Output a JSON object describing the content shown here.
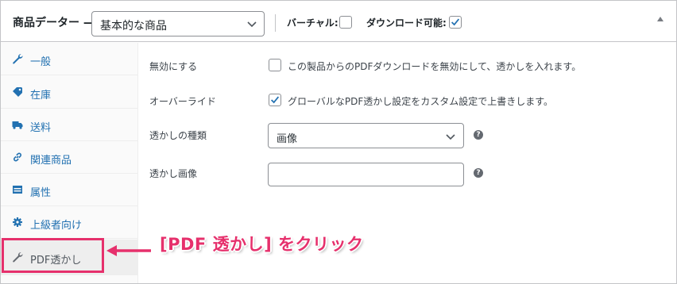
{
  "header": {
    "title": "商品データー —",
    "product_type": "基本的な商品",
    "virtual_label": "バーチャル:",
    "virtual_checked": false,
    "downloadable_label": "ダウンロード可能:",
    "downloadable_checked": true
  },
  "sidebar": {
    "items": [
      {
        "label": "一般",
        "icon": "wrench-icon"
      },
      {
        "label": "在庫",
        "icon": "tag-icon"
      },
      {
        "label": "送料",
        "icon": "truck-icon"
      },
      {
        "label": "関連商品",
        "icon": "link-icon"
      },
      {
        "label": "属性",
        "icon": "table-icon"
      },
      {
        "label": "上級者向け",
        "icon": "gear-icon"
      },
      {
        "label": "PDF透かし",
        "icon": "wrench-icon",
        "active": true
      }
    ]
  },
  "form": {
    "disable_label": "無効にする",
    "disable_text": "この製品からのPDFダウンロードを無効にして、透かしを入れます。",
    "disable_checked": false,
    "override_label": "オーバーライド",
    "override_text": "グローバルなPDF透かし設定をカスタム設定で上書きします。",
    "override_checked": true,
    "type_label": "透かしの種類",
    "type_value": "画像",
    "image_label": "透かし画像",
    "image_value": "",
    "help_glyph": "?"
  },
  "annotation": {
    "callout": "[PDF 透かし] をクリック",
    "color": "#e6306c"
  },
  "colors": {
    "link": "#2271b1",
    "checkbox_accent": "#2271b1"
  }
}
